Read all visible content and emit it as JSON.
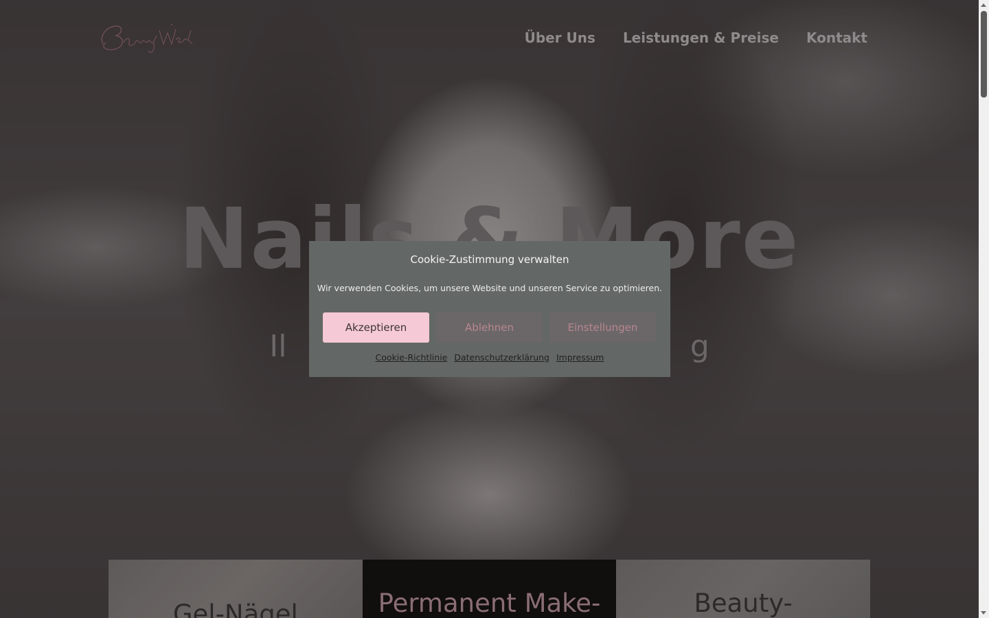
{
  "brand": {
    "logo_text": "BeautyWerk"
  },
  "nav": {
    "items": [
      {
        "label": "Über Uns"
      },
      {
        "label": "Leistungen & Preise"
      },
      {
        "label": "Kontakt"
      }
    ]
  },
  "hero": {
    "title": "Nails & More",
    "subtitle_visible": "Il                                          g"
  },
  "services": {
    "cards": [
      {
        "title": "Gel-Nägel"
      },
      {
        "title": "Permanent Make-"
      },
      {
        "title": "Beauty-"
      }
    ]
  },
  "cookie": {
    "title": "Cookie-Zustimmung verwalten",
    "text": "Wir verwenden Cookies, um unsere Website und unseren Service zu optimieren.",
    "accept_label": "Akzeptieren",
    "deny_label": "Ablehnen",
    "settings_label": "Einstellungen",
    "links": [
      {
        "label": "Cookie-Richtlinie"
      },
      {
        "label": "Datenschutzerklärung"
      },
      {
        "label": "Impressum"
      }
    ]
  },
  "colors": {
    "accent_pink": "#f5c9d6",
    "modal_bg": "#636866",
    "link_pink": "#b98690"
  }
}
